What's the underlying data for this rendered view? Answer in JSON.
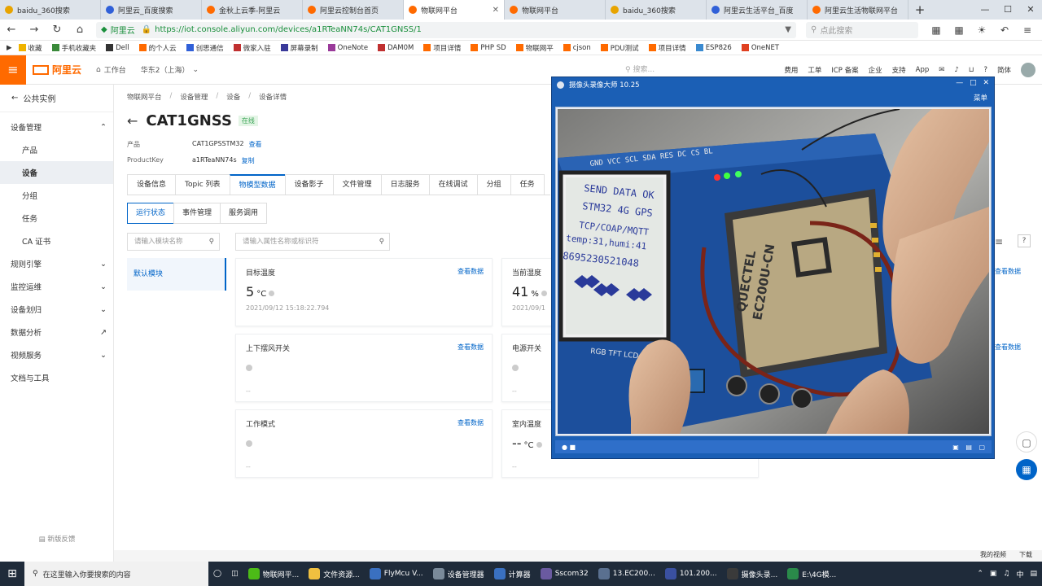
{
  "browser": {
    "tabs": [
      {
        "label": "baidu_360搜索",
        "color": "#e8a400"
      },
      {
        "label": "阿里云_百度搜索",
        "color": "#3060d8"
      },
      {
        "label": "金秋上云季-阿里云",
        "color": "#ff6a00"
      },
      {
        "label": "阿里云控制台首页",
        "color": "#ff6a00"
      },
      {
        "label": "物联网平台",
        "color": "#ff6a00",
        "active": true
      },
      {
        "label": "物联网平台",
        "color": "#ff6a00"
      },
      {
        "label": "baidu_360搜索",
        "color": "#e8a400"
      },
      {
        "label": "阿里云生活平台_百度",
        "color": "#3060d8"
      },
      {
        "label": "阿里云生活物联网平台",
        "color": "#ff6a00"
      }
    ],
    "new_tab": "+",
    "url_site": "阿里云",
    "url": "https://iot.console.aliyun.com/devices/a1RTeaNN74s/CAT1GNSS/1",
    "search_placeholder": "点此搜索",
    "bookmarks": [
      "收藏",
      "手机收藏夹",
      "Dell",
      "的个人云",
      "创思通信",
      "微家入驻",
      "屏幕录制",
      "OneNote",
      "DAM0M",
      "项目详情",
      "PHP SD",
      "物联网平",
      "cjson",
      "PDU测试",
      "项目详情",
      "ESP826",
      "OneNET"
    ]
  },
  "console": {
    "logo": "阿里云",
    "workbench": "工作台",
    "region": "华东2（上海）",
    "search_placeholder": "搜索...",
    "nav_right": [
      "费用",
      "工单",
      "ICP 备案",
      "企业",
      "支持",
      "App"
    ],
    "lang": "简体"
  },
  "sidebar": {
    "back_label": "公共实例",
    "items": [
      {
        "label": "设备管理",
        "type": "group",
        "expanded": true
      },
      {
        "label": "产品",
        "type": "sub"
      },
      {
        "label": "设备",
        "type": "sub",
        "active": true
      },
      {
        "label": "分组",
        "type": "sub"
      },
      {
        "label": "任务",
        "type": "sub"
      },
      {
        "label": "CA 证书",
        "type": "sub"
      },
      {
        "label": "规则引擎",
        "type": "group"
      },
      {
        "label": "监控运维",
        "type": "group"
      },
      {
        "label": "设备划归",
        "type": "group"
      },
      {
        "label": "数据分析",
        "type": "group"
      },
      {
        "label": "视频服务",
        "type": "group"
      },
      {
        "label": "文档与工具",
        "type": "group"
      }
    ],
    "footer": "新版反馈"
  },
  "main": {
    "breadcrumb": [
      "物联网平台",
      "设备管理",
      "设备",
      "设备详情"
    ],
    "device_name": "CAT1GNSS",
    "status": "在线",
    "product_key_label": "产品",
    "product_value": "CAT1GPSSTM32",
    "product_link": "查看",
    "pk_label": "ProductKey",
    "pk_value": "a1RTeaNN74s",
    "pk_link": "复制",
    "tabs": [
      "设备信息",
      "Topic 列表",
      "物模型数据",
      "设备影子",
      "文件管理",
      "日志服务",
      "在线调试",
      "分组",
      "任务"
    ],
    "active_tab": 2,
    "subtabs": [
      "运行状态",
      "事件管理",
      "服务调用"
    ],
    "module_search_placeholder": "请输入模块名称",
    "attr_search_placeholder": "请输入属性名称或标识符",
    "module_default": "默认模块",
    "cards": [
      {
        "title": "目标温度",
        "more": "查看数据",
        "value": "5",
        "unit": "°C",
        "time": "2021/09/12 15:18:22.794"
      },
      {
        "title": "当前湿度",
        "more": "查看数据",
        "value": "41",
        "unit": "%",
        "time": "2021/09/1"
      },
      {
        "title": "上下摆风开关",
        "more": "查看数据",
        "value": "",
        "unit": "",
        "time": "--"
      },
      {
        "title": "电源开关",
        "more": "查看数据",
        "value": "",
        "unit": "",
        "time": "--"
      },
      {
        "title": "工作模式",
        "more": "查看数据",
        "value": "",
        "unit": "",
        "time": "--"
      },
      {
        "title": "室内温度",
        "more": "查看数据",
        "value": "--",
        "unit": "°C",
        "time": "--"
      }
    ],
    "right_more": "查看数据"
  },
  "camera_window": {
    "title": "摄像头录像大师 10.25",
    "menu": "菜单",
    "lcd_lines": [
      "SEND DATA OK",
      "STM32 4G GPS",
      "TCP/COAP/MQTT",
      "temp:31,humi:41",
      "8695230521048"
    ],
    "board_text": [
      "GND VCC SCL SDA RES DC CS BL",
      "QUECTEL",
      "EC200U-CN",
      "RGB TFT LCD"
    ]
  },
  "browser_status": [
    "我的视频",
    "下载"
  ],
  "taskbar": {
    "search_placeholder": "在这里输入你要搜索的内容",
    "apps": [
      {
        "label": "物联网平...",
        "color": "#4cbb17"
      },
      {
        "label": "文件资源...",
        "color": "#f0c040"
      },
      {
        "label": "FlyMcu V...",
        "color": "#3a70c0"
      },
      {
        "label": "设备管理器",
        "color": "#7a8a9a"
      },
      {
        "label": "计算器",
        "color": "#3a70c0"
      },
      {
        "label": "Sscom32",
        "color": "#6a5aa0"
      },
      {
        "label": "13.EC200...",
        "color": "#5a7090"
      },
      {
        "label": "101.200...",
        "color": "#3a50a0"
      },
      {
        "label": "摄像头录...",
        "color": "#3a3a3a"
      },
      {
        "label": "E:\\4G模...",
        "color": "#2a8a4a"
      }
    ]
  }
}
